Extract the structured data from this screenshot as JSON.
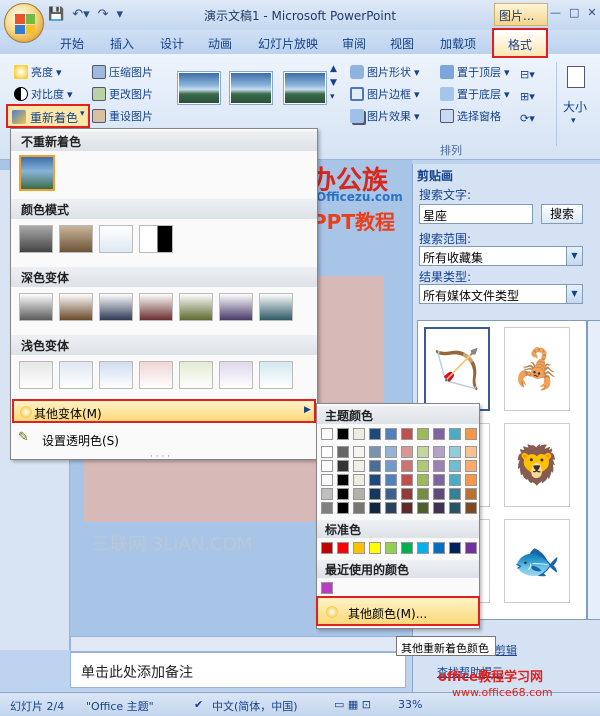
{
  "window": {
    "title": "演示文稿1 - Microsoft PowerPoint",
    "context_tab": "图片...",
    "controls": [
      "—",
      "□",
      "✕"
    ]
  },
  "tabs": [
    "开始",
    "插入",
    "设计",
    "动画",
    "幻灯片放映",
    "审阅",
    "视图",
    "加载项",
    "格式"
  ],
  "ribbon": {
    "brightness": "亮度",
    "contrast": "对比度",
    "recolor": "重新着色",
    "compress": "压缩图片",
    "change_picture": "更改图片",
    "reset_picture": "重设图片",
    "picture_shape": "图片形状",
    "picture_border": "图片边框",
    "picture_effects": "图片效果",
    "bring_front": "置于顶层",
    "send_back": "置于底层",
    "selection_pane": "选择窗格",
    "arrange_group": "排列",
    "size": "大小"
  },
  "recolor_menu": {
    "no_recolor": "不重新着色",
    "color_modes": "颜色模式",
    "dark_variations": "深色变体",
    "light_variations": "浅色变体",
    "more_variations": "其他变体(M)",
    "set_transparent": "设置透明色(S)",
    "dark_colors": [
      "#5a5a5a",
      "#6b4a2a",
      "#2f3a55",
      "#6a2f2f",
      "#5f6a2f",
      "#473a6a",
      "#2f5a66",
      "#7a4a24"
    ],
    "light_colors": [
      "#e6e6e6",
      "#dfe7f1",
      "#cfdcef",
      "#f0d6d6",
      "#e3ead2",
      "#dfd8ec",
      "#d3e9ef",
      "#f3e0cf"
    ]
  },
  "color_submenu": {
    "theme_colors": "主题颜色",
    "standard_colors": "标准色",
    "recent_colors": "最近使用的颜色",
    "more_colors": "其他颜色(M)...",
    "theme_top": [
      "#ffffff",
      "#000000",
      "#eeece1",
      "#1f497d",
      "#4f81bd",
      "#c0504d",
      "#9bbb59",
      "#8064a2",
      "#4bacc6",
      "#f79646"
    ],
    "standard": [
      "#c00000",
      "#ff0000",
      "#ffc000",
      "#ffff00",
      "#92d050",
      "#00b050",
      "#00b0f0",
      "#0070c0",
      "#002060",
      "#7030a0"
    ],
    "recent": [
      "#b83cc8"
    ]
  },
  "tooltip": "其他重新着色颜色",
  "clip_pane": {
    "title": "剪贴画",
    "search_label": "搜索文字:",
    "search_value": "星座",
    "search_button": "搜索",
    "scope_label": "搜索范围:",
    "scope_value": "所有收藏集",
    "type_label": "结果类型:",
    "type_value": "所有媒体文件类型",
    "bottom_link": "剪辑",
    "bottom_link2": "查找帮助提示"
  },
  "notes": "单击此处添加备注",
  "status": {
    "slide": "幻灯片 2/4",
    "theme": "\"Office 主题\"",
    "lang": "中文(简体，中国)",
    "zoom": "33%"
  },
  "watermarks": {
    "bangong": "办公族",
    "bangong_url": "Officezu.com",
    "ppt": "PPT教程",
    "sanlian": "三联网 3LIAN.COM",
    "office68": "office教程学习网",
    "office68_url": "www.office68.com"
  }
}
